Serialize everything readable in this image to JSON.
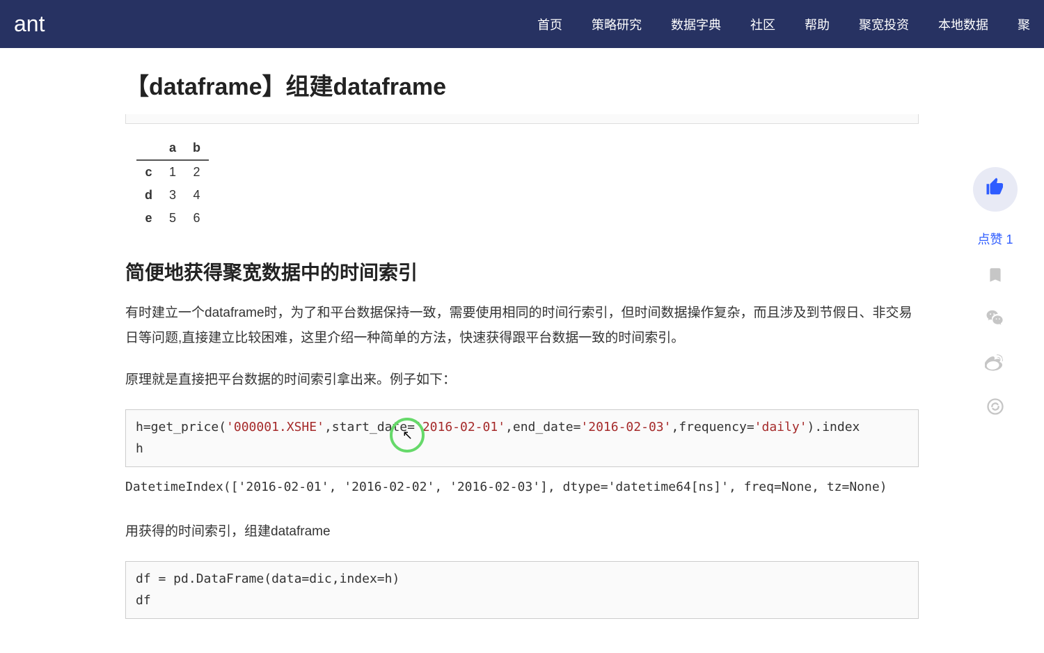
{
  "header": {
    "logo": "ant",
    "nav": [
      "首页",
      "策略研究",
      "数据字典",
      "社区",
      "帮助",
      "聚宽投资",
      "本地数据",
      "聚"
    ]
  },
  "title": "【dataframe】组建dataframe",
  "table1": {
    "cols": [
      "a",
      "b"
    ],
    "rows": [
      {
        "idx": "c",
        "vals": [
          "1",
          "2"
        ]
      },
      {
        "idx": "d",
        "vals": [
          "3",
          "4"
        ]
      },
      {
        "idx": "e",
        "vals": [
          "5",
          "6"
        ]
      }
    ]
  },
  "section2": {
    "heading": "简便地获得聚宽数据中的时间索引",
    "p1": "有时建立一个dataframe时，为了和平台数据保持一致，需要使用相同的时间行索引，但时间数据操作复杂，而且涉及到节假日、非交易日等问题,直接建立比较困难，这里介绍一种简单的方法，快速获得跟平台数据一致的时间索引。",
    "p2": "原理就是直接把平台数据的时间索引拿出来。例子如下：",
    "code1_pre": "h=get_price(",
    "code1_s1": "'000001.XSHE'",
    "code1_mid1": ",start_date=",
    "code1_s2": "'2016-02-01'",
    "code1_mid2": ",end_date=",
    "code1_s3": "'2016-02-03'",
    "code1_mid3": ",frequency=",
    "code1_s4": "'daily'",
    "code1_post": ").index\nh",
    "output1": "DatetimeIndex(['2016-02-01', '2016-02-02', '2016-02-03'], dtype='datetime64[ns]', freq=None, tz=None)",
    "p3": "用获得的时间索引，组建dataframe",
    "code2": "df = pd.DataFrame(data=dic,index=h)\ndf"
  },
  "sidebar": {
    "like_label": "点赞 1"
  }
}
